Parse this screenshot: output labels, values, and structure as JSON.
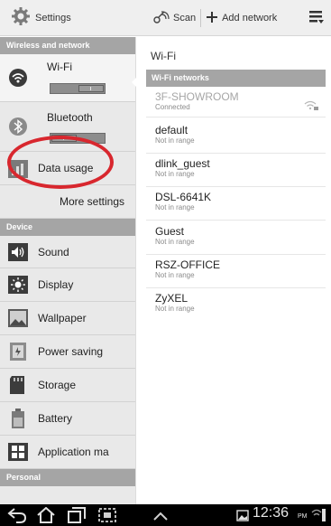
{
  "topbar": {
    "app_icon": "settings-gear-icon",
    "title": "Settings",
    "scan_label": "Scan",
    "scan_icon": "scan-icon",
    "add_network_label": "Add network",
    "add_icon": "plus-icon",
    "menu_icon": "menu-icon"
  },
  "left": {
    "sections": {
      "wireless": "Wireless and network",
      "device": "Device",
      "personal": "Personal"
    },
    "items": {
      "wifi": {
        "label": "Wi-Fi",
        "icon": "wifi-icon",
        "toggle_on": true
      },
      "bluetooth": {
        "label": "Bluetooth",
        "icon": "bluetooth-icon",
        "toggle_on": false
      },
      "data_usage": {
        "label": "Data usage",
        "icon": "data-usage-icon"
      },
      "more_settings": {
        "label": "More settings"
      },
      "sound": {
        "label": "Sound",
        "icon": "sound-icon"
      },
      "display": {
        "label": "Display",
        "icon": "display-icon"
      },
      "wallpaper": {
        "label": "Wallpaper",
        "icon": "wallpaper-icon"
      },
      "power_saving": {
        "label": "Power saving",
        "icon": "power-saving-icon"
      },
      "storage": {
        "label": "Storage",
        "icon": "storage-icon"
      },
      "battery": {
        "label": "Battery",
        "icon": "battery-icon"
      },
      "application_manager": {
        "label": "Application ma",
        "icon": "application-manager-icon"
      }
    },
    "highlight_color": "#d8272e"
  },
  "right": {
    "title": "Wi-Fi",
    "section": "Wi-Fi networks",
    "networks": [
      {
        "name": "3F-SHOWROOM",
        "status": "Connected"
      },
      {
        "name": "default",
        "status": "Not in range"
      },
      {
        "name": "dlink_guest",
        "status": "Not in range"
      },
      {
        "name": "DSL-6641K",
        "status": "Not in range"
      },
      {
        "name": "Guest",
        "status": "Not in range"
      },
      {
        "name": "RSZ-OFFICE",
        "status": "Not in range"
      },
      {
        "name": "ZyXEL",
        "status": "Not in range"
      }
    ]
  },
  "sysbar": {
    "time": "12:36",
    "ampm": "PM",
    "icons": [
      "back-icon",
      "home-icon",
      "recent-apps-icon",
      "screenshot-icon",
      "up-chevron-icon",
      "gallery-icon",
      "battery-status-icon"
    ]
  }
}
